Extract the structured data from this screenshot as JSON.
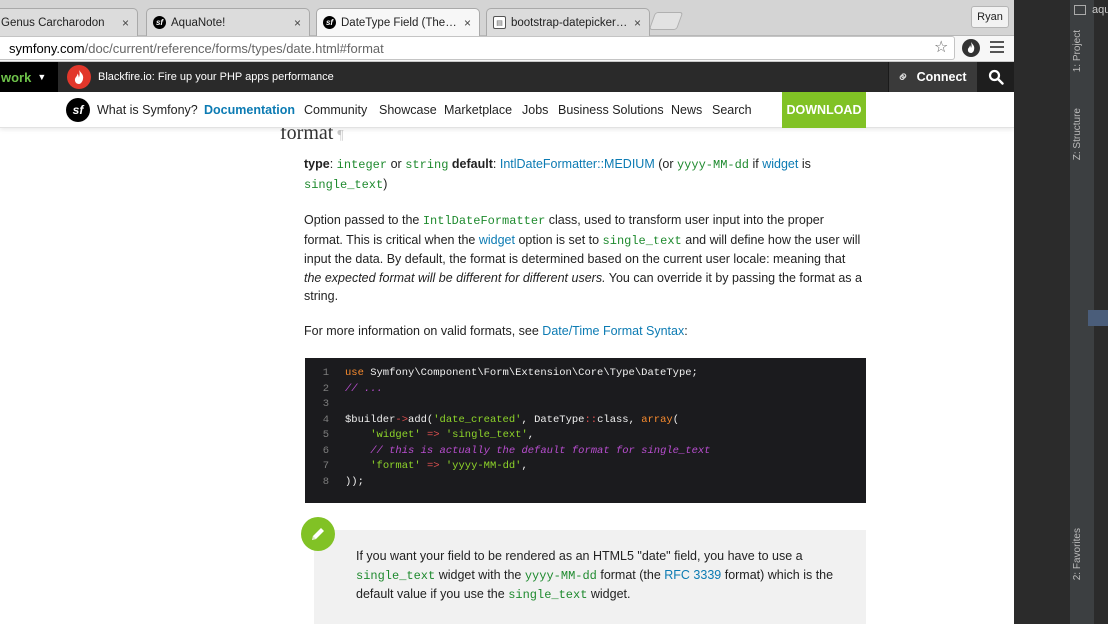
{
  "browser": {
    "tabs": [
      {
        "title": "Genus Carcharodon",
        "close": "×"
      },
      {
        "title": "AquaNote!",
        "close": "×"
      },
      {
        "title": "DateType Field (The Symfo",
        "close": "×"
      },
      {
        "title": "bootstrap-datepicker — bo",
        "close": "×"
      }
    ],
    "profile": "Ryan",
    "url_host": "symfony.com",
    "url_path": "/doc/current/reference/forms/types/date.html#format"
  },
  "blackfire_bar": {
    "workspace": "work",
    "banner": "Blackfire.io: Fire up your PHP apps performance",
    "connect": "Connect"
  },
  "nav": {
    "items": [
      "What is Symfony?",
      "Documentation",
      "Community",
      "Showcase",
      "Marketplace",
      "Jobs",
      "Business Solutions",
      "News",
      "Search"
    ],
    "download": "DOWNLOAD"
  },
  "content": {
    "heading": "format",
    "pilcrow": "¶",
    "type_line": {
      "type_label": "type",
      "colon": ":",
      "type1": "integer",
      "or": "or",
      "type2": "string",
      "default_label": "default",
      "default_value": "IntlDateFormatter::MEDIUM",
      "or_open": "(or",
      "alt_format": "yyyy-MM-dd",
      "if_word": "if",
      "widget_link": "widget",
      "is_word": "is",
      "single_text": "single_text",
      "close": ")"
    },
    "para1": {
      "t1": "Option passed to the ",
      "code1": "IntlDateFormatter",
      "t2": " class, used to transform user input into the proper format. This is critical when the ",
      "link1": "widget",
      "t3": " option is set to ",
      "code2": "single_text",
      "t4": " and will define how the user will input the data. By default, the format is determined based on the current user locale: meaning that ",
      "em": "the expected format will be different for different users.",
      "t5": " You can override it by passing the format as a string."
    },
    "para2": {
      "t1": "For more information on valid formats, see ",
      "link": "Date/Time Format Syntax",
      "t2": ":"
    },
    "code_lines": [
      {
        "n": "1"
      },
      {
        "n": "2"
      },
      {
        "n": "3"
      },
      {
        "n": "4"
      },
      {
        "n": "5"
      },
      {
        "n": "6"
      },
      {
        "n": "7"
      },
      {
        "n": "8"
      }
    ],
    "code": {
      "l1_kw": "use",
      "l1_rest": " Symfony\\Component\\Form\\Extension\\Core\\Type\\DateType;",
      "l2": "// ...",
      "l4_var": "$builder",
      "l4_arrow": "->",
      "l4_fn": "add(",
      "l4_str": "'date_created'",
      "l4_mid": ", DateType",
      "l4_dc": "::",
      "l4_cls": "class, ",
      "l4_arr": "array",
      "l4_paren": "(",
      "l5_key": "'widget'",
      "l5_arrow": "=>",
      "l5_val": "'single_text'",
      "l5_comma": ",",
      "l6": "// this is actually the default format for single_text",
      "l7_key": "'format'",
      "l7_arrow": "=>",
      "l7_val": "'yyyy-MM-dd'",
      "l7_comma": ",",
      "l8": "));"
    },
    "note": {
      "t1": "If you want your field to be rendered as an HTML5 \"date\" field, you have to use a ",
      "code1": "single_text",
      "t2": " widget with the ",
      "code2": "yyyy-MM-dd",
      "t3": " format (the ",
      "link": "RFC 3339",
      "t4": " format) which is the default value if you use the ",
      "code3": "single_text",
      "t5": " widget."
    }
  },
  "ide": {
    "top_label": "aqu",
    "tab_project": "1: Project",
    "tab_structure": "Z: Structure",
    "tab_favorites": "2: Favorites"
  },
  "colors": {
    "symfony_green": "#81c225",
    "link_blue": "#0c7bb3",
    "code_green": "#1e8a2e",
    "blackfire_red": "#e2372b"
  }
}
